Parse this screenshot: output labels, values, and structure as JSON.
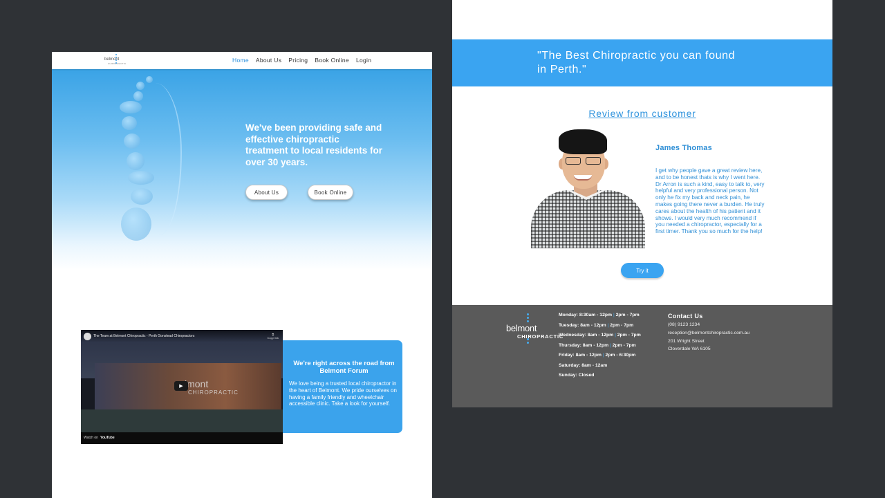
{
  "left_mockup": {
    "logo": {
      "word": "belmont",
      "sub": "CHIROPRACTIC"
    },
    "nav": [
      {
        "label": "Home",
        "active": true
      },
      {
        "label": "About Us",
        "active": false
      },
      {
        "label": "Pricing",
        "active": false
      },
      {
        "label": "Book Online",
        "active": false
      },
      {
        "label": "Login",
        "active": false
      }
    ],
    "hero": {
      "headline": "We've been providing safe and effective chiropractic treatment to local residents for over 30 years.",
      "about_button": "About Us",
      "book_button": "Book Online"
    },
    "video": {
      "title": "The Team at Belmont Chiropractic - Perth Gonstead Chiropractors",
      "copy_link": "Copy link",
      "sign_word": "lmont",
      "sign_sub": "CHIROPRACTIC",
      "watch_on": "Watch on",
      "youtube": "YouTube"
    },
    "info_card": {
      "title": "We're right across the road from Belmont Forum",
      "body": "We love being a trusted local chiropractor in the heart of Belmont. We pride ourselves on having a family friendly and wheelchair accessible clinic. Take a look for yourself."
    }
  },
  "right_mockup": {
    "quote": "\"The Best Chiropractic you can found in Perth.\"",
    "review_heading": "Review from customer",
    "reviewer_name": "James Thomas",
    "review_text": "I get why people gave a great review here, and to be honest thats is why I went here. Dr Arron is such a kind, easy to talk to, very helpful and very professional person. Not only he fix my back and neck pain, he makes going there never a burden. He truly cares about the health of his patient and it shows. I would very much recommend if you needed a chiropractor, especially for a first timer. Thank you so much for the help!",
    "try_button": "Try it",
    "footer": {
      "logo_word": "belmont",
      "logo_sub": "CHIROPRACTIC",
      "hours": [
        {
          "day": "Monday:",
          "slots": [
            "8:30am - 12pm",
            "2pm - 7pm"
          ]
        },
        {
          "day": "Tuesday:",
          "slots": [
            "8am - 12pm",
            "2pm - 7pm"
          ]
        },
        {
          "day": "Wednesday:",
          "slots": [
            "8am - 12pm",
            "2pm - 7pm"
          ]
        },
        {
          "day": "Thursday:",
          "slots": [
            "8am - 12pm",
            "2pm - 7pm"
          ]
        },
        {
          "day": "Friday:",
          "slots": [
            "8am - 12pm",
            "2pm - 6:30pm"
          ]
        },
        {
          "day": "Saturday:",
          "slots": [
            "8am - 12am"
          ]
        },
        {
          "day": "Sunday:",
          "slots": [
            "Closed"
          ]
        }
      ],
      "contact_title": "Contact Us",
      "phone": "(08) 9123 1234",
      "email": "reception@belmontchiropractic.com.au",
      "address1": "201 Wright Street",
      "address2": "Cloverdale WA 6105"
    }
  },
  "colors": {
    "accent": "#3aa4f1",
    "background": "#2f3236",
    "footer": "#5a5a5a"
  }
}
